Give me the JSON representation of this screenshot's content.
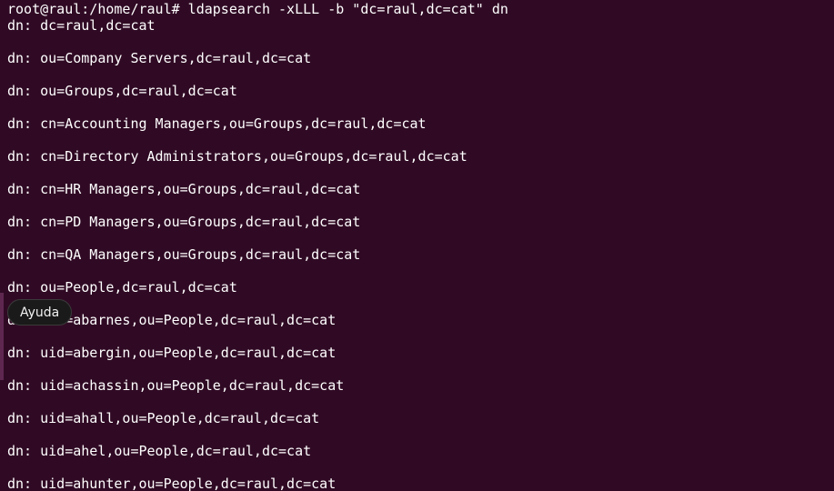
{
  "terminal": {
    "command_line": "root@raul:/home/raul# ldapsearch -xLLL -b \"dc=raul,dc=cat\" dn",
    "output": [
      "dn: dc=raul,dc=cat",
      "",
      "dn: ou=Company Servers,dc=raul,dc=cat",
      "",
      "dn: ou=Groups,dc=raul,dc=cat",
      "",
      "dn: cn=Accounting Managers,ou=Groups,dc=raul,dc=cat",
      "",
      "dn: cn=Directory Administrators,ou=Groups,dc=raul,dc=cat",
      "",
      "dn: cn=HR Managers,ou=Groups,dc=raul,dc=cat",
      "",
      "dn: cn=PD Managers,ou=Groups,dc=raul,dc=cat",
      "",
      "dn: cn=QA Managers,ou=Groups,dc=raul,dc=cat",
      "",
      "dn: ou=People,dc=raul,dc=cat",
      "",
      "dn: uid=abarnes,ou=People,dc=raul,dc=cat",
      "",
      "dn: uid=abergin,ou=People,dc=raul,dc=cat",
      "",
      "dn: uid=achassin,ou=People,dc=raul,dc=cat",
      "",
      "dn: uid=ahall,ou=People,dc=raul,dc=cat",
      "",
      "dn: uid=ahel,ou=People,dc=raul,dc=cat",
      "",
      "dn: uid=ahunter,ou=People,dc=raul,dc=cat"
    ]
  },
  "tooltip": {
    "label": "Ayuda"
  },
  "colors": {
    "background": "#300a24",
    "text": "#ffffff",
    "tooltip_background": "#1a1a1a"
  }
}
